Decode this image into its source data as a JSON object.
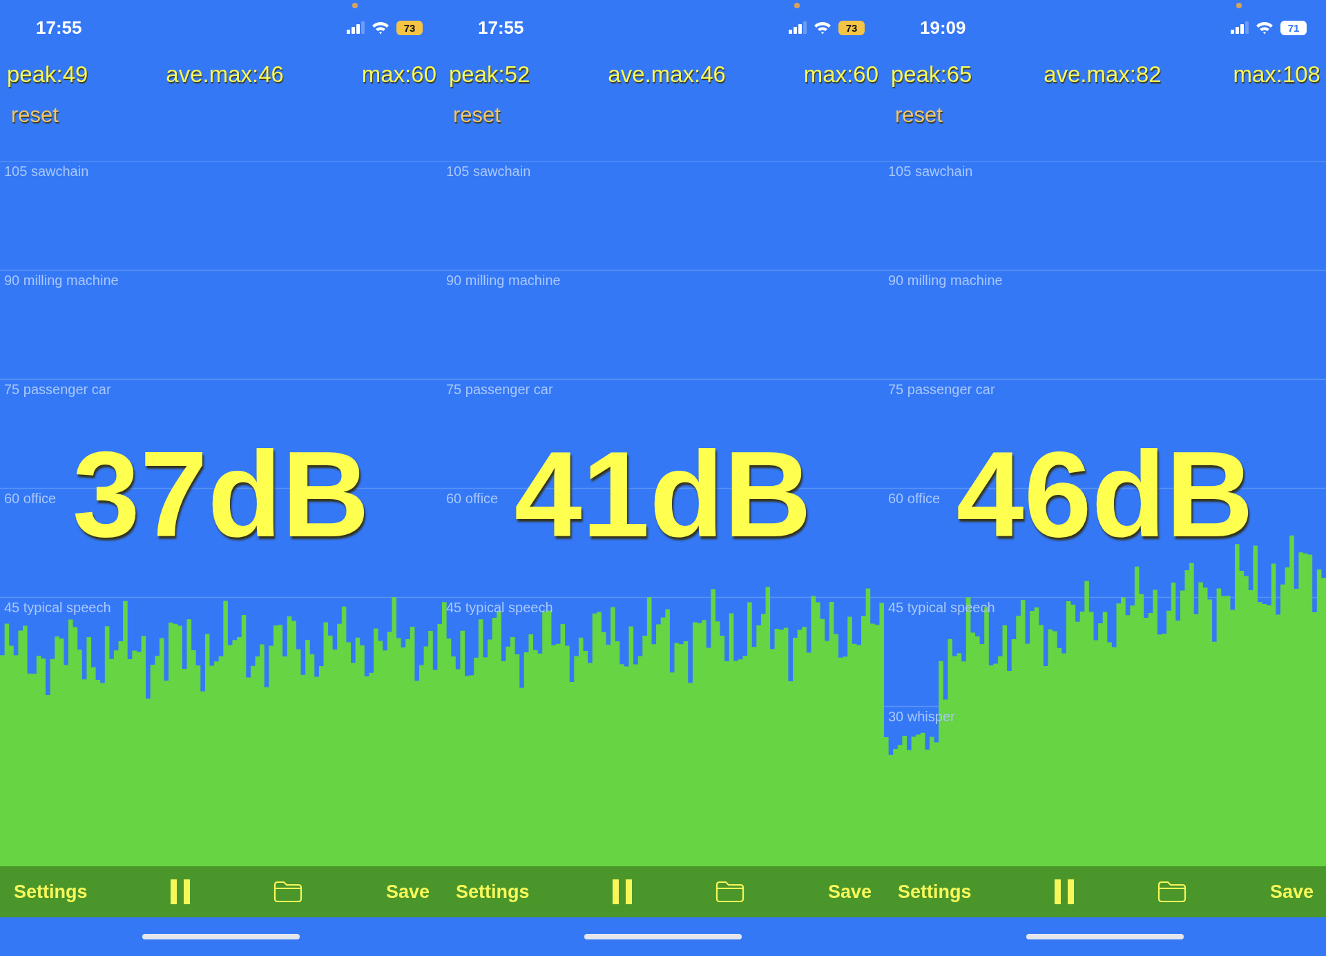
{
  "panels": [
    {
      "status": {
        "time": "17:55",
        "battery": "73",
        "low_power": true,
        "mic_in_use": true
      },
      "stats": {
        "peak": "peak:49",
        "ave_max": "ave.max:46",
        "max": "max:60"
      },
      "reset": "reset",
      "scale": [
        "105 sawchain",
        "90 milling machine",
        "75 passenger car",
        "60 office",
        "45 typical speech"
      ],
      "reading": "37dB",
      "toolbar": {
        "settings": "Settings",
        "save": "Save"
      }
    },
    {
      "status": {
        "time": "17:55",
        "battery": "73",
        "low_power": true,
        "mic_in_use": true
      },
      "stats": {
        "peak": "peak:52",
        "ave_max": "ave.max:46",
        "max": "max:60"
      },
      "reset": "reset",
      "scale": [
        "105 sawchain",
        "90 milling machine",
        "75 passenger car",
        "60 office",
        "45 typical speech"
      ],
      "reading": "41dB",
      "toolbar": {
        "settings": "Settings",
        "save": "Save"
      }
    },
    {
      "status": {
        "time": "19:09",
        "battery": "71",
        "low_power": false,
        "mic_in_use": true
      },
      "stats": {
        "peak": "peak:65",
        "ave_max": "ave.max:82",
        "max": "max:108"
      },
      "reset": "reset",
      "scale": [
        "105 sawchain",
        "90 milling machine",
        "75 passenger car",
        "60 office",
        "45 typical speech",
        "30 whisper"
      ],
      "reading": "46dB",
      "toolbar": {
        "settings": "Settings",
        "save": "Save"
      }
    }
  ]
}
